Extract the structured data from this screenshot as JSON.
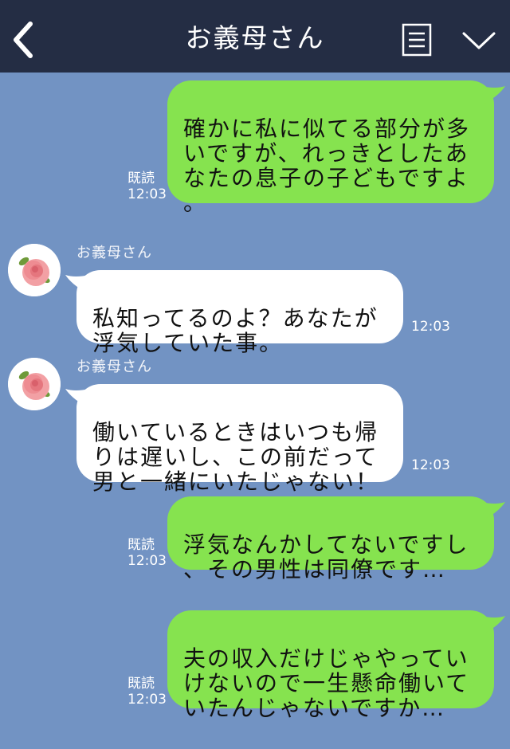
{
  "header": {
    "title": "お義母さん",
    "back_icon": "chevron-left-icon",
    "menu_icon": "list-icon",
    "more_icon": "chevron-down-icon"
  },
  "messages": [
    {
      "side": "right",
      "text": "確かに私に似てる部分が多\nいですが、れっきとしたあ\nなたの息子の子どもですよ\n。",
      "read": "既読",
      "time": "12:03"
    },
    {
      "side": "left",
      "sender": "お義母さん",
      "text": "私知ってるのよ？あなたが\n浮気していた事。",
      "time": "12:03"
    },
    {
      "side": "left",
      "sender": "お義母さん",
      "text": "働いているときはいつも帰\nりは遅いし、この前だって\n男と一緒にいたじゃない！",
      "time": "12:03"
    },
    {
      "side": "right",
      "text": "浮気なんかしてないですし\n、その男性は同僚です…",
      "read": "既読",
      "time": "12:03"
    },
    {
      "side": "right",
      "text": "夫の収入だけじゃやってい\nけないので一生懸命働いて\nいたんじゃないですか…",
      "read": "既読",
      "time": "12:03"
    }
  ],
  "colors": {
    "header": "#242d44",
    "background": "#7293c3",
    "bubble_sent": "#86e34f",
    "bubble_received": "#ffffff"
  },
  "avatar_icon": "rose-avatar-icon"
}
